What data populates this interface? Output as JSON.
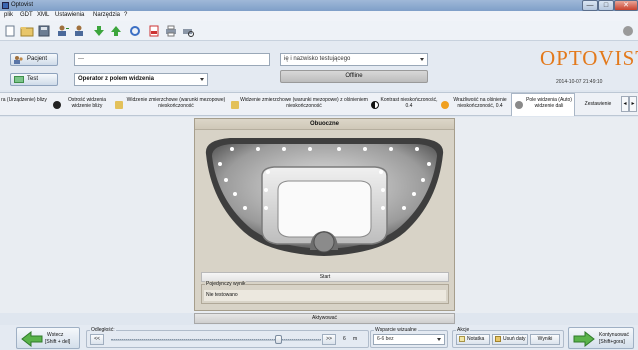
{
  "window": {
    "title": "Optovist",
    "min_glyph": "—",
    "max_glyph": "□",
    "close_glyph": "✕"
  },
  "menu": {
    "items": [
      "plik",
      "GDT",
      "XML",
      "Ustawienia",
      "Narzędzia",
      "?"
    ]
  },
  "toolbar": {
    "icons": [
      "new-document-icon",
      "open-folder-icon",
      "save-icon",
      "user-add-icon",
      "user-edit-icon",
      "arrow-down-icon",
      "arrow-up-icon",
      "refresh-icon",
      "pdf-icon",
      "print-icon",
      "print-preview-icon",
      "help-icon"
    ]
  },
  "patient": {
    "button_label": "Pacjent",
    "field_value": "---",
    "test_button_label": "Test",
    "test_select_value": "Operator z polem widzenia",
    "operator_select_value": "ię i nazwisko testującego",
    "status": "Offline"
  },
  "brand": {
    "logo": "OPTOVIST",
    "datetime": "2014-10-07  21:49:10"
  },
  "tabs": [
    {
      "label": "ra (Urządzenie) blizy"
    },
    {
      "label": "Ostrość widzenia widzenie bliży"
    },
    {
      "label": "Widzenie zmierzchowe (warunki mezopowe) nieskończoność"
    },
    {
      "label": "Widzenie zmierzchowe (warunki mezopowe) z olśnieniem nieskończoność"
    },
    {
      "label": "Kontrast nieskończoność, 0.4"
    },
    {
      "label": "Wrażliwość na olśnienie nieskończoność, 0.4"
    },
    {
      "label": "Pole widzenia (Auto) widzenie dali"
    },
    {
      "label": "Zestawienie"
    }
  ],
  "panel": {
    "title": "Obuoczne",
    "start_label": "Start",
    "result_legend": "Pojedynczy wynik",
    "result_value": "Nie testowano"
  },
  "activate_label": "Aktywować",
  "bottom": {
    "back_label": "Wstecz",
    "back_shortcut": "[Shift + del]",
    "distance_legend": "Odległość:",
    "distance_value": "6",
    "distance_unit": "m",
    "distance_level": 0.8,
    "visual_support_legend": "Wsparcie wizualne",
    "visual_support_value": "6-6 bez",
    "actions_legend": "Akcje",
    "note_label": "Notatka",
    "delete_label": "Usuń daty",
    "results_label": "Wyniki",
    "continue_label": "Kontynuować",
    "continue_shortcut": "[Shift+gora]"
  }
}
